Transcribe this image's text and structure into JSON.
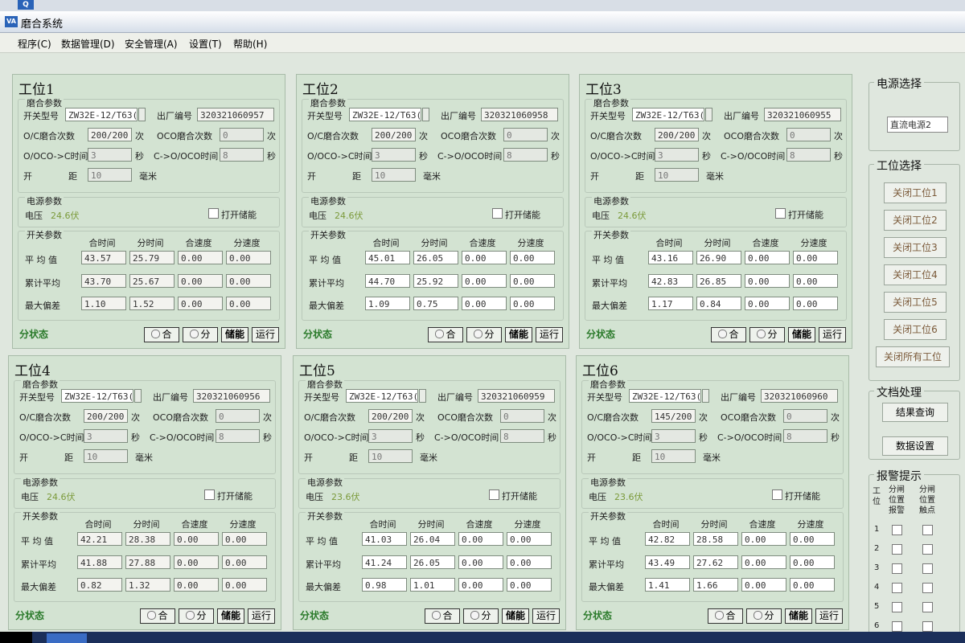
{
  "window": {
    "title": "磨合系统",
    "logo": "Q"
  },
  "menu": [
    "程序(C)",
    "数据管理(D)",
    "安全管理(A)",
    "设置(T)",
    "帮助(H)"
  ],
  "labels": {
    "break_in": "磨合参数",
    "switch_model": "开关型号",
    "serial": "出厂编号",
    "oc_count": "O/C磨合次数",
    "oco_count": "OCO磨合次数",
    "times_unit": "次",
    "oco_to_c": "O/OCO->C时间",
    "c_to_oco": "C->O/OCO时间",
    "sec": "秒",
    "gap_a": "开",
    "gap_b": "距",
    "mm": "毫米",
    "power": "电源参数",
    "voltage": "电压",
    "open_storage": "打开储能",
    "switch_params": "开关参数",
    "col_close_time": "合时间",
    "col_open_time": "分时间",
    "col_close_speed": "合速度",
    "col_open_speed": "分速度",
    "row_avg": "平 均 值",
    "row_cum": "累计平均",
    "row_max": "最大偏差",
    "status": "分状态",
    "btn_close": "合",
    "btn_open": "分",
    "btn_storage": "储能",
    "btn_run": "运行"
  },
  "stations": [
    {
      "title": "工位1",
      "model": "ZW32E-12/T63(",
      "serial": "320321060957",
      "oc": "200/200",
      "oco": "0",
      "t1": "3",
      "t2": "8",
      "gap": "10",
      "voltage": "24.6伏",
      "rows": [
        [
          "43.57",
          "25.79",
          "0.00",
          "0.00"
        ],
        [
          "43.70",
          "25.67",
          "0.00",
          "0.00"
        ],
        [
          "1.10",
          "1.52",
          "0.00",
          "0.00"
        ]
      ]
    },
    {
      "title": "工位2",
      "model": "ZW32E-12/T63(",
      "serial": "320321060958",
      "oc": "200/200",
      "oco": "0",
      "t1": "3",
      "t2": "8",
      "gap": "10",
      "voltage": "24.6伏",
      "rows": [
        [
          "45.01",
          "26.05",
          "0.00",
          "0.00"
        ],
        [
          "44.70",
          "25.92",
          "0.00",
          "0.00"
        ],
        [
          "1.09",
          "0.75",
          "0.00",
          "0.00"
        ]
      ]
    },
    {
      "title": "工位3",
      "model": "ZW32E-12/T63(",
      "serial": "320321060955",
      "oc": "200/200",
      "oco": "0",
      "t1": "3",
      "t2": "8",
      "gap": "10",
      "voltage": "24.6伏",
      "rows": [
        [
          "43.16",
          "26.90",
          "0.00",
          "0.00"
        ],
        [
          "42.83",
          "26.85",
          "0.00",
          "0.00"
        ],
        [
          "1.17",
          "0.84",
          "0.00",
          "0.00"
        ]
      ]
    },
    {
      "title": "工位4",
      "model": "ZW32E-12/T63(",
      "serial": "320321060956",
      "oc": "200/200",
      "oco": "0",
      "t1": "3",
      "t2": "8",
      "gap": "10",
      "voltage": "24.6伏",
      "rows": [
        [
          "42.21",
          "28.38",
          "0.00",
          "0.00"
        ],
        [
          "41.88",
          "27.88",
          "0.00",
          "0.00"
        ],
        [
          "0.82",
          "1.32",
          "0.00",
          "0.00"
        ]
      ]
    },
    {
      "title": "工位5",
      "model": "ZW32E-12/T63(",
      "serial": "320321060959",
      "oc": "200/200",
      "oco": "0",
      "t1": "3",
      "t2": "8",
      "gap": "10",
      "voltage": "23.6伏",
      "rows": [
        [
          "41.03",
          "26.04",
          "0.00",
          "0.00"
        ],
        [
          "41.24",
          "26.05",
          "0.00",
          "0.00"
        ],
        [
          "0.98",
          "1.01",
          "0.00",
          "0.00"
        ]
      ]
    },
    {
      "title": "工位6",
      "model": "ZW32E-12/T63(",
      "serial": "320321060960",
      "oc": "145/200",
      "oco": "0",
      "t1": "3",
      "t2": "8",
      "gap": "10",
      "voltage": "23.6伏",
      "rows": [
        [
          "42.82",
          "28.58",
          "0.00",
          "0.00"
        ],
        [
          "43.49",
          "27.62",
          "0.00",
          "0.00"
        ],
        [
          "1.41",
          "1.66",
          "0.00",
          "0.00"
        ]
      ]
    }
  ],
  "right": {
    "power_title": "电源选择",
    "power_value": "直流电源2",
    "station_title": "工位选择",
    "station_buttons": [
      "关闭工位1",
      "关闭工位2",
      "关闭工位3",
      "关闭工位4",
      "关闭工位5",
      "关闭工位6",
      "关闭所有工位"
    ],
    "doc_title": "文档处理",
    "doc_buttons": [
      "结果查询",
      "数据设置"
    ],
    "alarm_title": "报警提示",
    "alarm_headers": [
      "工位",
      "分闸位置报警",
      "分闸位置触点"
    ],
    "alarm_rows": [
      "1",
      "2",
      "3",
      "4",
      "5",
      "6"
    ]
  }
}
